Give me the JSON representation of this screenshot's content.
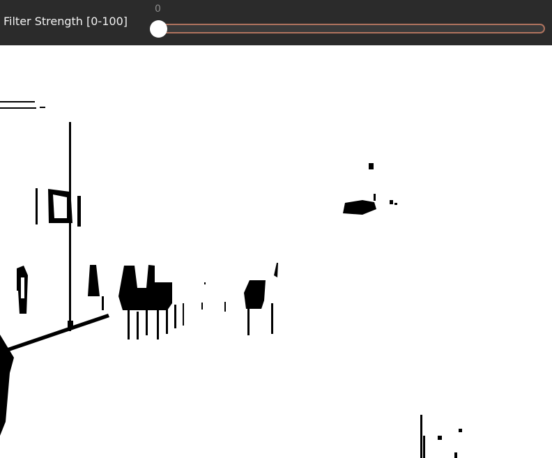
{
  "toolbar": {
    "slider_label": "Filter Strength [0-100]",
    "slider_value": "0",
    "slider_min": 0,
    "slider_max": 100,
    "slider_level": 0,
    "accent_color": "#b0735e",
    "background_color": "#2b2b2b"
  },
  "canvas": {
    "content": "binary-threshold-image"
  }
}
